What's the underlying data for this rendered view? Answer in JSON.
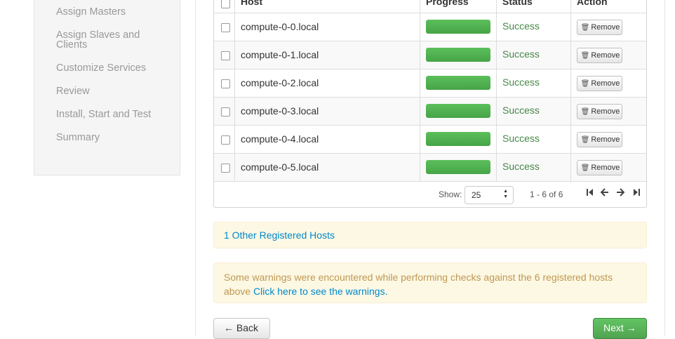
{
  "sidebar": {
    "items": [
      {
        "label": "Assign Masters"
      },
      {
        "label": "Assign Slaves and Clients"
      },
      {
        "label": "Customize Services"
      },
      {
        "label": "Review"
      },
      {
        "label": "Install, Start and Test"
      },
      {
        "label": "Summary"
      }
    ]
  },
  "table": {
    "headers": {
      "host": "Host",
      "progress": "Progress",
      "status": "Status",
      "action": "Action"
    },
    "rows": [
      {
        "host": "compute-0-0.local",
        "progress": 1.0,
        "status": "Success",
        "action": "Remove"
      },
      {
        "host": "compute-0-1.local",
        "progress": 1.0,
        "status": "Success",
        "action": "Remove"
      },
      {
        "host": "compute-0-2.local",
        "progress": 1.0,
        "status": "Success",
        "action": "Remove"
      },
      {
        "host": "compute-0-3.local",
        "progress": 1.0,
        "status": "Success",
        "action": "Remove"
      },
      {
        "host": "compute-0-4.local",
        "progress": 1.0,
        "status": "Success",
        "action": "Remove"
      },
      {
        "host": "compute-0-5.local",
        "progress": 1.0,
        "status": "Success",
        "action": "Remove"
      }
    ]
  },
  "pagination": {
    "show_label": "Show:",
    "page_size": "25",
    "range": "1 - 6 of 6",
    "icons": [
      "first-page-icon",
      "prev-page-icon",
      "next-page-icon",
      "last-page-icon"
    ]
  },
  "alerts": {
    "registered_hosts_link": "1 Other Registered Hosts",
    "warning_text": "Some warnings were encountered while performing checks against the 6 registered hosts above ",
    "warning_link": "Click here to see the warnings."
  },
  "buttons": {
    "back": "← Back",
    "next": "Next →"
  },
  "colors": {
    "success_text": "#468847",
    "progress_fill": "#51a351",
    "link": "#0088cc",
    "warning_text": "#c09853",
    "warning_bg": "#fcf8e3"
  }
}
